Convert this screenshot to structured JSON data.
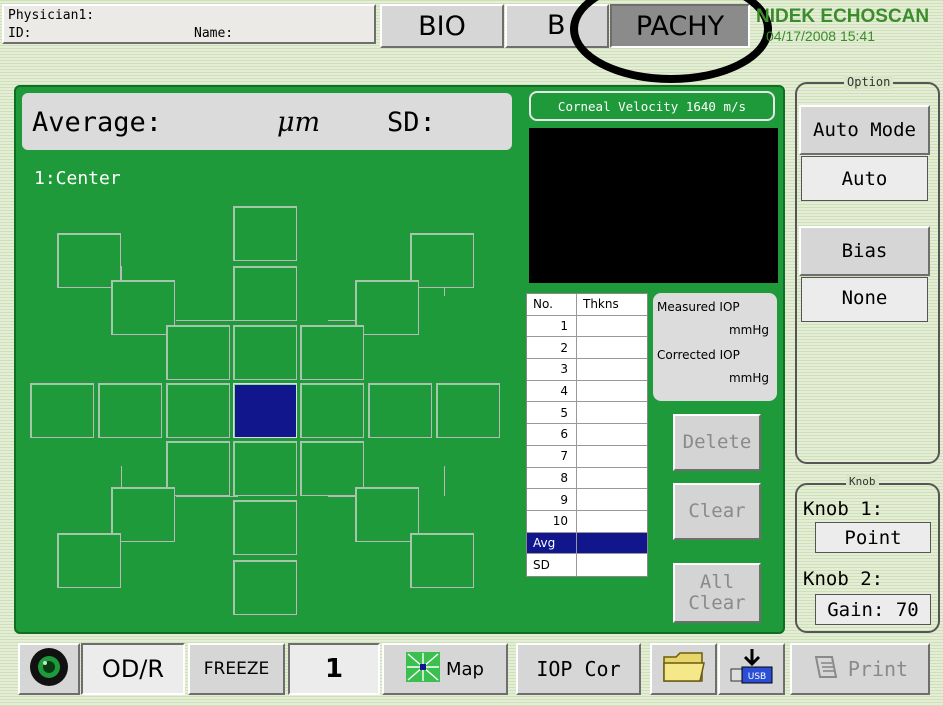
{
  "header": {
    "physician_label": "Physician1:",
    "id_label": "ID:",
    "name_label": "Name:",
    "tabs": [
      {
        "label": "BIO"
      },
      {
        "label": "B"
      },
      {
        "label": "PACHY"
      }
    ],
    "brand": "NIDEK ECHOSCAN",
    "datetime": "04/17/2008 15:41"
  },
  "main": {
    "average_label": "Average:",
    "unit": "μm",
    "sd_label": "SD:",
    "position": "1:Center",
    "velocity": "Corneal Velocity 1640 m/s",
    "table": {
      "headers": [
        "No.",
        "Thkns"
      ],
      "rows": [
        "1",
        "2",
        "3",
        "4",
        "5",
        "6",
        "7",
        "8",
        "9",
        "10"
      ],
      "avg_label": "Avg",
      "sd_label": "SD"
    },
    "iop": {
      "measured_label": "Measured IOP",
      "measured_unit": "mmHg",
      "corrected_label": "Corrected IOP",
      "corrected_unit": "mmHg"
    },
    "delete_label": "Delete",
    "clear_label": "Clear",
    "all_clear_label": "All Clear"
  },
  "option": {
    "title": "Option",
    "auto_mode_label": "Auto Mode",
    "auto_value": "Auto",
    "bias_label": "Bias",
    "bias_value": "None"
  },
  "knob": {
    "title": "Knob",
    "knob1_label": "Knob 1:",
    "knob1_value": "Point",
    "knob2_label": "Knob 2:",
    "knob2_value": "Gain: 70"
  },
  "footer": {
    "eye_label": "OD/R",
    "freeze_label": "FREEZE",
    "counter": "1",
    "map_label": "Map",
    "iop_cor_label": "IOP Cor",
    "usb_label": "USB",
    "print_label": "Print"
  }
}
